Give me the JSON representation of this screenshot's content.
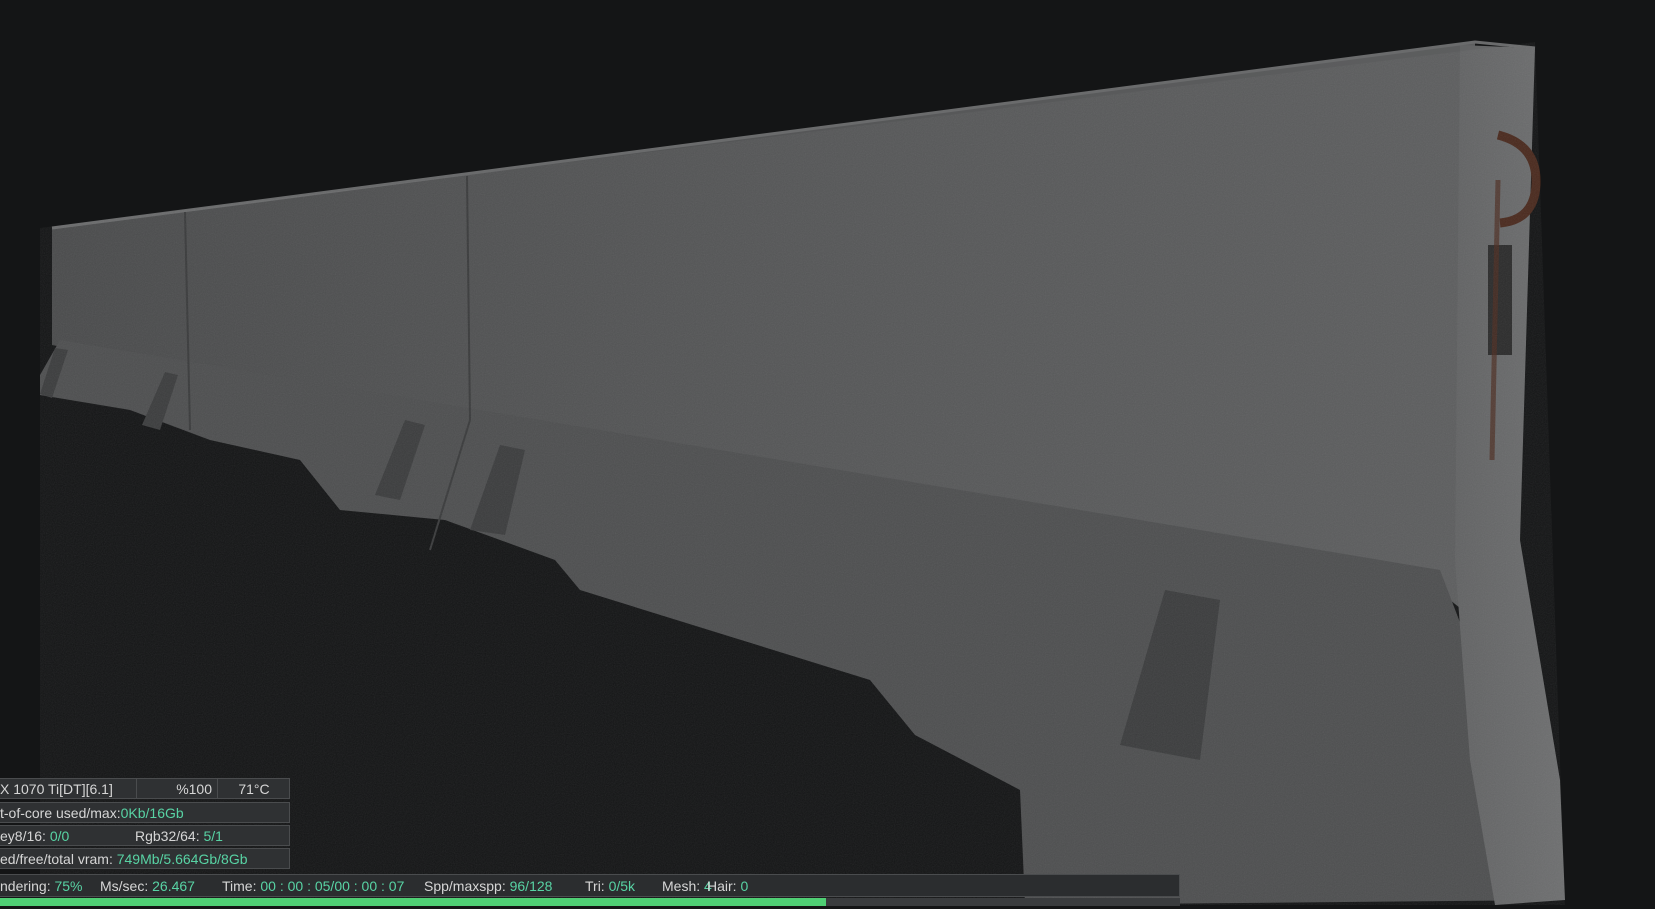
{
  "hud": {
    "gpu": {
      "name": "X 1070 Ti[DT][6.1]",
      "usage": "%100",
      "temp": "71°C"
    },
    "out_of_core": {
      "label": "t-of-core used/max:",
      "used": "0Kb",
      "slash": "/",
      "max": "16Gb"
    },
    "textures": {
      "grey_label": "ey8/16:",
      "grey_value": "0/0",
      "rgb_label": "Rgb32/64:",
      "rgb_value": "5/1"
    },
    "vram": {
      "label": "ed/free/total vram:",
      "used": "749Mb",
      "free": "5.664Gb",
      "total": "8Gb",
      "slash": "/"
    },
    "status": {
      "rendering_label": "ndering:",
      "rendering_value": "75%",
      "ms_label": "Ms/sec:",
      "ms_value": "26.467",
      "time_label": "Time:",
      "time_value": "00 : 00 : 05/00 : 00 : 07",
      "spp_label": "Spp/maxspp:",
      "spp_value": "96/128",
      "tri_label": "Tri:",
      "tri_value": "0/5k",
      "mesh_label": "Mesh:",
      "mesh_value": "4",
      "hair_label": "Hair:",
      "hair_value": "0"
    },
    "progress": 0.75
  },
  "colors": {
    "background": "#141516",
    "concrete": "#545555",
    "accent_value": "#58d3a4",
    "progress": "#4fcf74"
  }
}
